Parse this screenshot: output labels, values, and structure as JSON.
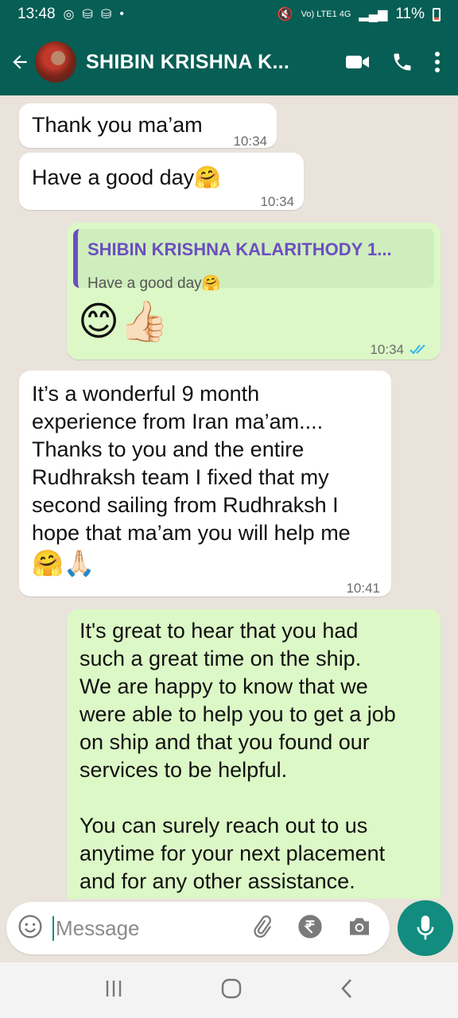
{
  "status_bar": {
    "time": "13:48",
    "network": "Vo) LTE1 4G",
    "battery": "11%"
  },
  "header": {
    "contact_name": "SHIBIN KRISHNA K..."
  },
  "messages": [
    {
      "direction": "in",
      "text": "Thank you ma’am",
      "time": "10:34"
    },
    {
      "direction": "in",
      "text": "Have a good day",
      "emoji": "🤗",
      "time": "10:34"
    },
    {
      "direction": "out",
      "quote_name": "SHIBIN KRISHNA KALARITHODY 1...",
      "quote_text": "Have a good day",
      "quote_emoji": "🤗",
      "emojis": "😊👍🏻",
      "time": "10:34",
      "status": "read"
    },
    {
      "direction": "in",
      "lines": [
        "It’s a wonderful 9 month",
        "experience from Iran ma’am....",
        "Thanks to you and the entire",
        "Rudhraksh team I fixed that my",
        "second sailing from Rudhraksh I",
        "hope that ma’am you will help me"
      ],
      "emoji_line": "🤗🙏🏻",
      "time": "10:41"
    },
    {
      "direction": "out",
      "lines": [
        "It's great to hear that you had",
        "such a great time on the ship.",
        "We are happy to know that we",
        "were able to help you to get a job",
        "on ship and that you found our",
        "services to be helpful.",
        "",
        "You can surely reach out to us",
        "anytime for your next placement",
        "and for any other assistance."
      ]
    }
  ],
  "input": {
    "placeholder": "Message"
  },
  "colors": {
    "header": "#075e54",
    "accent": "#128c7e",
    "outgoing_bubble": "#dcf8c6",
    "incoming_bubble": "#ffffff",
    "quote_name": "#6c4ec0",
    "read_tick": "#34b7f1"
  },
  "icons": [
    "back-arrow-icon",
    "video-call-icon",
    "phone-icon",
    "more-vert-icon",
    "emoji-icon",
    "attach-icon",
    "rupee-icon",
    "camera-icon",
    "mic-icon",
    "recents-icon",
    "home-icon",
    "back-nav-icon"
  ]
}
